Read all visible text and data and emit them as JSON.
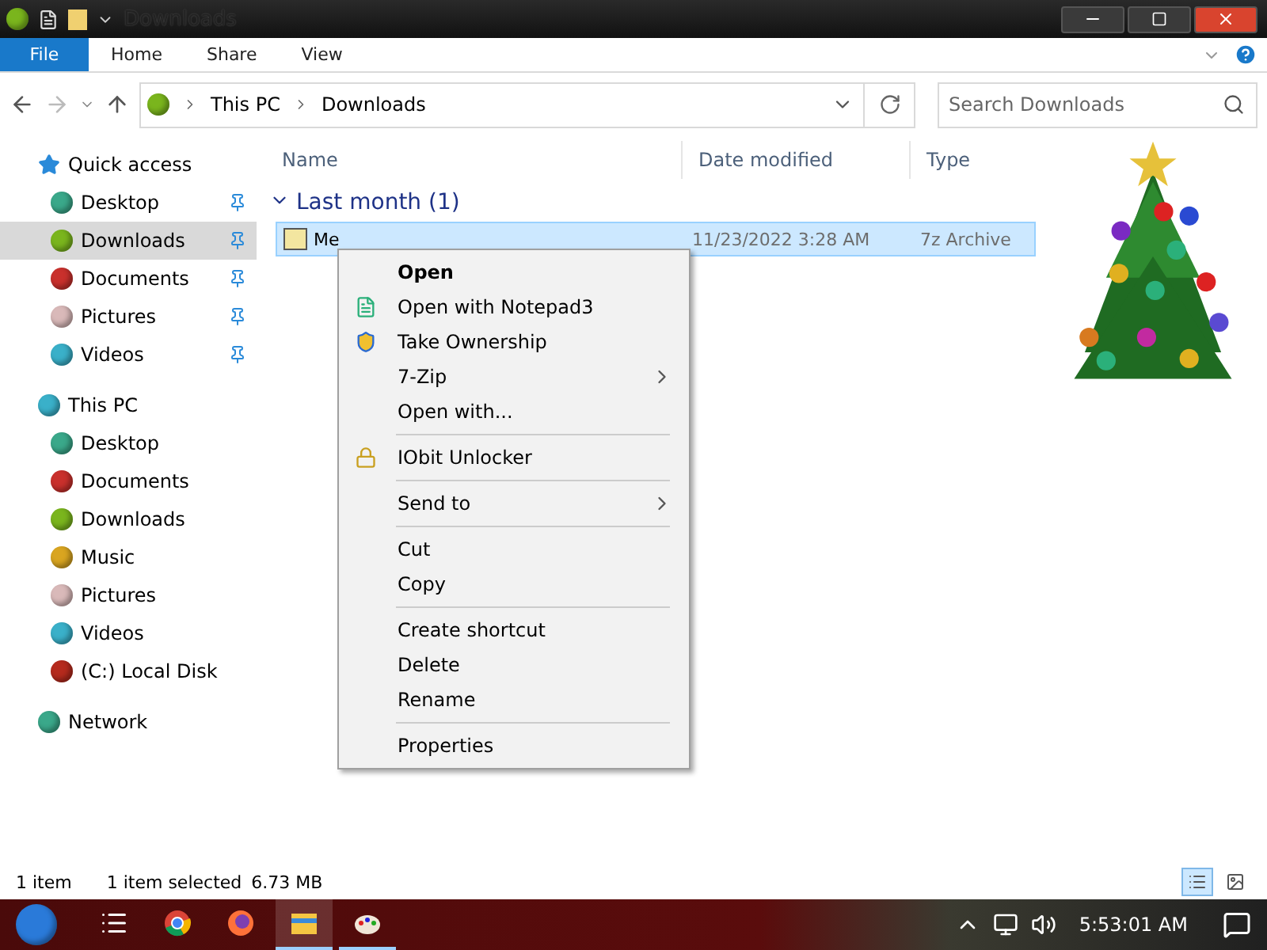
{
  "window": {
    "title": "Downloads"
  },
  "ribbon_tabs": [
    {
      "label": "File",
      "kind": "file"
    },
    {
      "label": "Home",
      "kind": "tab"
    },
    {
      "label": "Share",
      "kind": "tab"
    },
    {
      "label": "View",
      "kind": "tab"
    }
  ],
  "address": {
    "path": [
      "This PC",
      "Downloads"
    ]
  },
  "search": {
    "placeholder": "Search Downloads"
  },
  "sidebar": {
    "items": [
      {
        "label": "Quick access",
        "kind": "star",
        "selected": false,
        "children": [
          {
            "label": "Desktop",
            "color": "#3aa88a",
            "pinned": true,
            "selected": false
          },
          {
            "label": "Downloads",
            "color": "#7ab51d",
            "pinned": true,
            "selected": true
          },
          {
            "label": "Documents",
            "color": "#c9302c",
            "pinned": true,
            "selected": false
          },
          {
            "label": "Pictures",
            "color": "#d9b9b9",
            "pinned": true,
            "selected": false
          },
          {
            "label": "Videos",
            "color": "#3ab0c9",
            "pinned": true,
            "selected": false
          }
        ]
      },
      {
        "label": "This PC",
        "kind": "orb",
        "color": "#3ab0c9",
        "selected": false,
        "children": [
          {
            "label": "Desktop",
            "color": "#3aa88a",
            "pinned": false,
            "selected": false
          },
          {
            "label": "Documents",
            "color": "#c9302c",
            "pinned": false,
            "selected": false
          },
          {
            "label": "Downloads",
            "color": "#7ab51d",
            "pinned": false,
            "selected": false
          },
          {
            "label": "Music",
            "color": "#d9a520",
            "pinned": false,
            "selected": false
          },
          {
            "label": "Pictures",
            "color": "#d9b9b9",
            "pinned": false,
            "selected": false
          },
          {
            "label": "Videos",
            "color": "#3ab0c9",
            "pinned": false,
            "selected": false
          },
          {
            "label": "(C:) Local Disk",
            "color": "#b52a1d",
            "pinned": false,
            "selected": false
          }
        ]
      },
      {
        "label": "Network",
        "kind": "orb",
        "color": "#3aa88a",
        "selected": false
      }
    ]
  },
  "columns": [
    "Name",
    "Date modified",
    "Type"
  ],
  "groups": [
    {
      "label": "Last month (1)",
      "expanded": true,
      "files": [
        {
          "name": "Me",
          "date": "11/23/2022 3:28 AM",
          "type": "7z Archive",
          "selected": true
        }
      ]
    }
  ],
  "context_menu": {
    "sections": [
      [
        {
          "label": "Open",
          "default": true,
          "submenu": false,
          "kind": "plain"
        },
        {
          "label": "Open with Notepad3",
          "default": false,
          "submenu": false,
          "kind": "notepad"
        },
        {
          "label": "Take Ownership",
          "default": false,
          "submenu": false,
          "kind": "shield"
        },
        {
          "label": "7-Zip",
          "default": false,
          "submenu": true,
          "kind": "plain"
        },
        {
          "label": "Open with...",
          "default": false,
          "submenu": false,
          "kind": "plain"
        }
      ],
      [
        {
          "label": "IObit Unlocker",
          "default": false,
          "submenu": false,
          "kind": "lock"
        }
      ],
      [
        {
          "label": "Send to",
          "default": false,
          "submenu": true,
          "kind": "plain"
        }
      ],
      [
        {
          "label": "Cut",
          "default": false,
          "submenu": false,
          "kind": "plain"
        },
        {
          "label": "Copy",
          "default": false,
          "submenu": false,
          "kind": "plain"
        }
      ],
      [
        {
          "label": "Create shortcut",
          "default": false,
          "submenu": false,
          "kind": "plain"
        },
        {
          "label": "Delete",
          "default": false,
          "submenu": false,
          "kind": "plain"
        },
        {
          "label": "Rename",
          "default": false,
          "submenu": false,
          "kind": "plain"
        }
      ],
      [
        {
          "label": "Properties",
          "default": false,
          "submenu": false,
          "kind": "plain"
        }
      ]
    ]
  },
  "status_bar": {
    "count": "1 item",
    "selection": "1 item selected",
    "size": "6.73 MB"
  },
  "taskbar": {
    "apps": [
      {
        "kind": "taskview",
        "running": false
      },
      {
        "kind": "chrome",
        "running": false
      },
      {
        "kind": "firefox",
        "running": false
      },
      {
        "kind": "explorer",
        "running": true
      },
      {
        "kind": "paint",
        "running": true
      }
    ],
    "clock": "5:53:01 AM"
  }
}
